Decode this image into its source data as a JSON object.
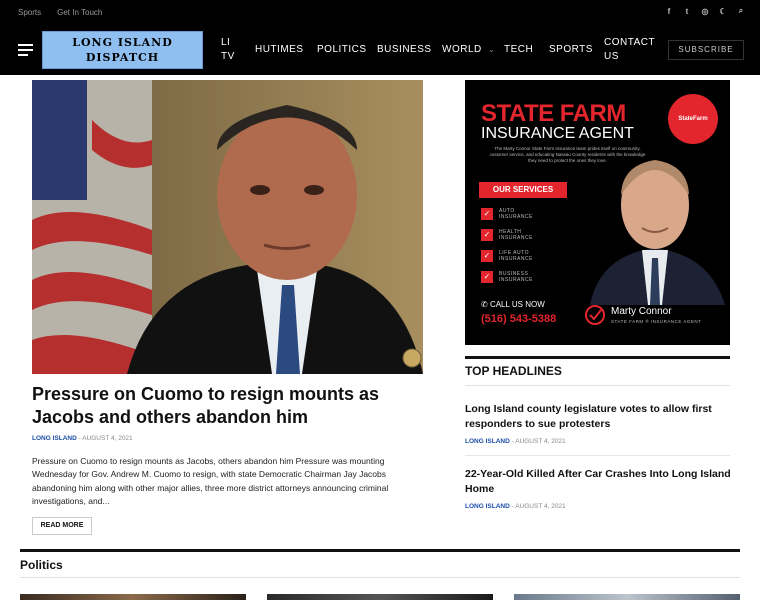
{
  "topbar": {
    "links": [
      "Sports",
      "Get In Touch"
    ],
    "social_icons": [
      "facebook-icon",
      "twitter-icon",
      "instagram-icon",
      "dark-mode-icon",
      "search-icon"
    ],
    "social_glyphs": [
      "f",
      "t",
      "◎",
      "☾",
      "⌕"
    ]
  },
  "nav": {
    "logo_line1": "LONG ISLAND",
    "logo_line2": "DISPATCH",
    "items": {
      "litv_1": "LI",
      "litv_2": "TV",
      "hutimes": "HUTIMES",
      "politics": "POLITICS",
      "business": "BUSINESS",
      "world": "WORLD",
      "world_caret": "⌄",
      "tech": "TECH",
      "sports": "SPORTS",
      "contact_1": "CONTACT",
      "contact_2": "US"
    },
    "subscribe": "SUBSCRIBE"
  },
  "hero": {
    "title": "Pressure on Cuomo to resign mounts as Jacobs and others abandon him",
    "category": "LONG ISLAND",
    "date": "- AUGUST 4, 2021",
    "excerpt": "Pressure on Cuomo to resign mounts as Jacobs, others abandon him Pressure was mounting Wednesday for Gov. Andrew M. Cuomo to resign, with state Democratic Chairman Jay Jacobs abandoning him along with other major allies, three more district attorneys announcing criminal investigations, and...",
    "read_more": "READ MORE"
  },
  "ad": {
    "title1": "STATE FARM",
    "title2": "INSURANCE AGENT",
    "logo_text": "StateFarm",
    "blurb": "The Marty Connor State Farm Insurance team prides itself on community, customer service, and educating Nassau County residents with the knowledge they need to protect the ones they love.",
    "services_label": "OUR SERVICES",
    "check": "✓",
    "services": [
      {
        "l1": "AUTO",
        "l2": "INSURANCE"
      },
      {
        "l1": "HEALTH",
        "l2": "INSURANCE"
      },
      {
        "l1": "LIFE AUTO",
        "l2": "INSURANCE"
      },
      {
        "l1": "BUSINESS",
        "l2": "INSURANCE"
      }
    ],
    "call": "CALL US NOW",
    "phone_icon": "✆",
    "phone": "(516) 543-5388",
    "agent_name": "Marty Connor",
    "agent_sub": "STATE FARM ® INSURANCE AGENT"
  },
  "top_headlines": {
    "title": "TOP HEADLINES",
    "items": [
      {
        "title": "Long Island county legislature votes to allow first responders to sue protesters",
        "category": "LONG ISLAND",
        "date": "- AUGUST 4, 2021"
      },
      {
        "title": "22-Year-Old Killed After Car Crashes Into Long Island Home",
        "category": "LONG ISLAND",
        "date": "- AUGUST 4, 2021"
      }
    ]
  },
  "politics": {
    "title": "Politics"
  },
  "colors": {
    "nav_bg": "#000000",
    "logo_bg": "#8fbff0",
    "category_blue": "#1b4ea8",
    "statefarm_red": "#e3252e"
  }
}
